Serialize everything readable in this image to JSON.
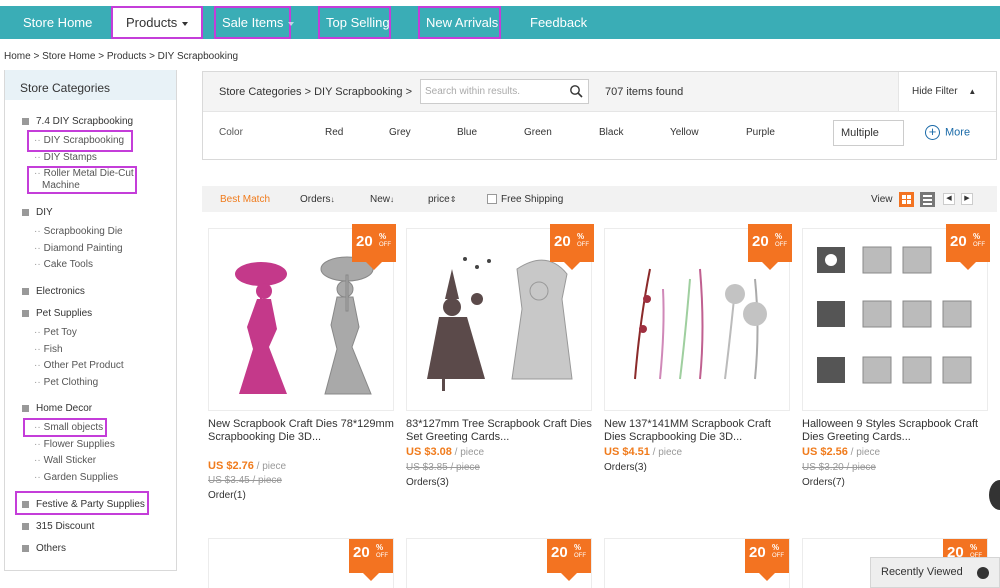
{
  "nav": {
    "store_home": "Store Home",
    "products": "Products",
    "sale_items": "Sale Items",
    "top_selling": "Top Selling",
    "new_arrivals": "New Arrivals",
    "feedback": "Feedback"
  },
  "breadcrumb": "Home > Store Home > Products > DIY Scrapbooking",
  "sidebar": {
    "title": "Store Categories",
    "cats": {
      "c1": "7.4 DIY Scrapbooking",
      "c1s1": "DIY Scrapbooking",
      "c1s2": "DIY Stamps",
      "c1s3a": "Roller Metal Die-Cut",
      "c1s3b": "Machine",
      "c2": "DIY",
      "c2s1": "Scrapbooking Die",
      "c2s2": "Diamond Painting",
      "c2s3": "Cake Tools",
      "c3": "Electronics",
      "c4": "Pet Supplies",
      "c4s1": "Pet Toy",
      "c4s2": "Fish",
      "c4s3": "Other Pet Product",
      "c4s4": "Pet Clothing",
      "c5": "Home Decor",
      "c5s1": "Small objects",
      "c5s2": "Flower Supplies",
      "c5s3": "Wall Sticker",
      "c5s4": "Garden Supplies",
      "c6": "Festive & Party Supplies",
      "c7": "315 Discount",
      "c8": "Others"
    }
  },
  "filter": {
    "path": "Store Categories > DIY Scrapbooking >",
    "search_placeholder": "Search within results.",
    "found": "707 items found",
    "hide": "Hide Filter",
    "color_label": "Color",
    "colors": {
      "red": "Red",
      "grey": "Grey",
      "blue": "Blue",
      "green": "Green",
      "black": "Black",
      "yellow": "Yellow",
      "purple": "Purple"
    },
    "multiple": "Multiple",
    "more": "More"
  },
  "sort": {
    "best": "Best Match",
    "orders": "Orders",
    "new": "New",
    "price": "price",
    "free_shipping": "Free Shipping",
    "view": "View"
  },
  "products": [
    {
      "title": "New Scrapbook Craft Dies 78*129mm Scrapbooking Die 3D...",
      "price": "US $2.76",
      "unit": " / piece",
      "old": "US $3.45 / piece",
      "orders": "Order(1)",
      "badge": "20"
    },
    {
      "title": "83*127mm Tree Scrapbook Craft Dies Set Greeting Cards...",
      "price": "US $3.08",
      "unit": " / piece",
      "old": "US $3.85 / piece",
      "orders": "Orders(3)",
      "badge": "20"
    },
    {
      "title": "New 137*141MM Scrapbook Craft Dies Scrapbooking Die 3D...",
      "price": "US $4.51",
      "unit": " / piece",
      "old": "",
      "orders": "Orders(3)",
      "badge": "20"
    },
    {
      "title": "Halloween 9 Styles Scrapbook Craft Dies Greeting Cards...",
      "price": "US $2.56",
      "unit": " / piece",
      "old": "US $3.20 / piece",
      "orders": "Orders(7)",
      "badge": "20"
    }
  ],
  "badge_pct": "%",
  "badge_off": "OFF",
  "recently_viewed": "Recently Viewed",
  "colors": {
    "nav_bg": "#3aadb6",
    "accent": "#f07b1c",
    "badge": "#f37321",
    "highlight": "#c43dd9"
  }
}
